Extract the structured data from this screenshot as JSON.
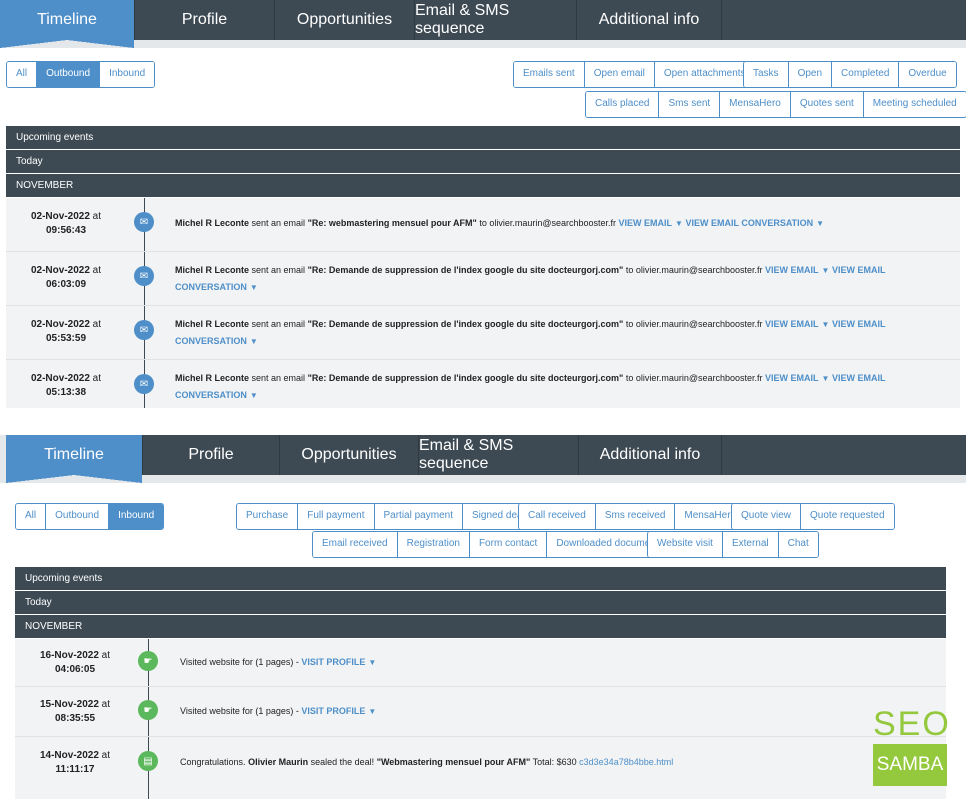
{
  "top": {
    "tabs": [
      "Timeline",
      "Profile",
      "Opportunities",
      "Email & SMS sequence",
      "Additional info"
    ],
    "direction": [
      "All",
      "Outbound",
      "Inbound"
    ],
    "filters_row1_a": [
      "Emails sent",
      "Open email",
      "Open attachments"
    ],
    "filters_row1_b": [
      "Tasks",
      "Open",
      "Completed",
      "Overdue"
    ],
    "filters_row2": [
      "Calls placed",
      "Sms sent",
      "MensaHero",
      "Quotes sent",
      "Meeting scheduled"
    ],
    "sections": [
      "Upcoming events",
      "Today",
      "NOVEMBER"
    ],
    "events": [
      {
        "date": "02-Nov-2022",
        "at": "at",
        "time": "09:56:43",
        "sender": "Michel R Leconte",
        "mid": "sent an email",
        "subject": "\"Re: webmastering mensuel pour AFM\"",
        "to": "to olivier.maurin@searchbooster.fr",
        "link1": "VIEW EMAIL",
        "link2": "VIEW EMAIL CONVERSATION"
      },
      {
        "date": "02-Nov-2022",
        "at": "at",
        "time": "06:03:09",
        "sender": "Michel R Leconte",
        "mid": "sent an email",
        "subject": "\"Re: Demande de suppression de l'index google du site docteurgorj.com\"",
        "to": "to olivier.maurin@searchbooster.fr",
        "link1": "VIEW EMAIL",
        "link2a": "VIEW EMAIL",
        "link2b": "CONVERSATION"
      },
      {
        "date": "02-Nov-2022",
        "at": "at",
        "time": "05:53:59",
        "sender": "Michel R Leconte",
        "mid": "sent an email",
        "subject": "\"Re: Demande de suppression de l'index google du site docteurgorj.com\"",
        "to": "to olivier.maurin@searchbooster.fr",
        "link1": "VIEW EMAIL",
        "link2a": "VIEW EMAIL",
        "link2b": "CONVERSATION"
      },
      {
        "date": "02-Nov-2022",
        "at": "at",
        "time": "05:13:38",
        "sender": "Michel R Leconte",
        "mid": "sent an email",
        "subject": "\"Re: Demande de suppression de l'index google du site docteurgorj.com\"",
        "to": "to olivier.maurin@searchbooster.fr",
        "link1": "VIEW EMAIL",
        "link2a": "VIEW EMAIL",
        "link2b": "CONVERSATION"
      }
    ]
  },
  "bottom": {
    "tabs": [
      "Timeline",
      "Profile",
      "Opportunities",
      "Email & SMS sequence",
      "Additional info"
    ],
    "direction": [
      "All",
      "Outbound",
      "Inbound"
    ],
    "filters_row1_a": [
      "Purchase",
      "Full payment",
      "Partial payment",
      "Signed deal"
    ],
    "filters_row1_b": [
      "Call received",
      "Sms received",
      "MensaHero"
    ],
    "filters_row1_c": [
      "Quote view",
      "Quote requested"
    ],
    "filters_row2_a": [
      "Email received",
      "Registration",
      "Form contact",
      "Downloaded document"
    ],
    "filters_row2_b": [
      "Website visit",
      "External",
      "Chat"
    ],
    "sections": [
      "Upcoming events",
      "Today",
      "NOVEMBER"
    ],
    "events": [
      {
        "date": "16-Nov-2022",
        "at": "at",
        "time": "04:06:05",
        "text": "Visited website for (1 pages) -",
        "link": "VISIT PROFILE"
      },
      {
        "date": "15-Nov-2022",
        "at": "at",
        "time": "08:35:55",
        "text": "Visited website for (1 pages) -",
        "link": "VISIT PROFILE"
      },
      {
        "date": "14-Nov-2022",
        "at": "at",
        "time": "11:11:17",
        "pre": "Congratulations.",
        "name": "Olivier Maurin",
        "mid": "sealed the deal!",
        "deal": "\"Webmastering mensuel pour AFM\"",
        "total": "Total: $630",
        "file": "c3d3e34a78b4bbe.html"
      }
    ]
  },
  "logo": {
    "line1": "SEO",
    "line2": "SAMBA"
  }
}
